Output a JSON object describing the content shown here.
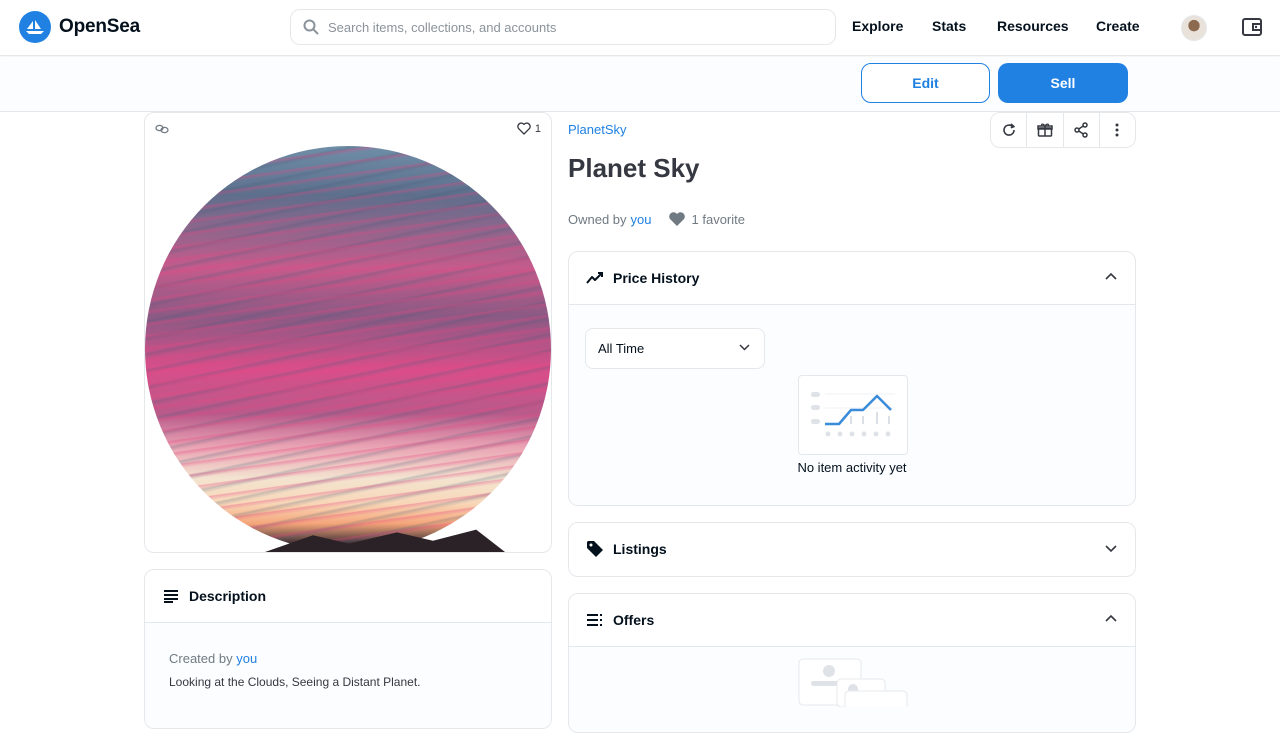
{
  "nav": {
    "brand": "OpenSea",
    "search_placeholder": "Search items, collections, and accounts",
    "links": [
      "Explore",
      "Stats",
      "Resources",
      "Create"
    ]
  },
  "actions": {
    "edit": "Edit",
    "sell": "Sell"
  },
  "asset": {
    "favorite_count": "1",
    "collection": "PlanetSky",
    "title": "Planet Sky",
    "owned_by_label": "Owned by",
    "owner": "you",
    "favorites_text": "1 favorite"
  },
  "description": {
    "title": "Description",
    "created_by_label": "Created by",
    "creator": "you",
    "text": "Looking at the Clouds, Seeing a Distant Planet."
  },
  "price_history": {
    "title": "Price History",
    "range_selected": "All Time",
    "empty_text": "No item activity yet"
  },
  "listings": {
    "title": "Listings"
  },
  "offers": {
    "title": "Offers"
  },
  "colors": {
    "accent": "#2081e2",
    "text": "#353840",
    "border": "#e5e8eb"
  }
}
